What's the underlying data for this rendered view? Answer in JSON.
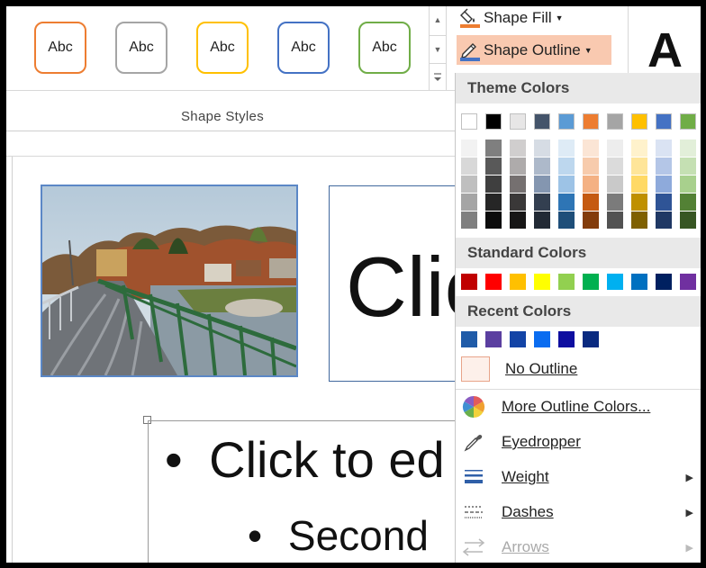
{
  "ribbon": {
    "style_buttons": [
      {
        "label": "Abc",
        "border": "#ed7d31"
      },
      {
        "label": "Abc",
        "border": "#a5a5a5"
      },
      {
        "label": "Abc",
        "border": "#ffc000"
      },
      {
        "label": "Abc",
        "border": "#4472c4"
      },
      {
        "label": "Abc",
        "border": "#70ad47"
      }
    ],
    "group_label": "Shape Styles",
    "shape_fill": "Shape Fill",
    "shape_outline": "Shape Outline",
    "wordart_glyph": "A"
  },
  "slide": {
    "title_text": "Clic",
    "bullet1": "Click to ed",
    "bullet2": "Second"
  },
  "dropdown": {
    "theme_colors_label": "Theme Colors",
    "theme_top_row": [
      "#ffffff",
      "#000000",
      "#e7e6e6",
      "#44546a",
      "#5b9bd5",
      "#ed7d31",
      "#a5a5a5",
      "#ffc000",
      "#4472c4",
      "#70ad47"
    ],
    "theme_shades": [
      [
        "#f2f2f2",
        "#7f7f7f",
        "#d0cece",
        "#d6dce4",
        "#deebf6",
        "#fbe5d5",
        "#ededed",
        "#fff2cc",
        "#dae3f3",
        "#e2efd9"
      ],
      [
        "#d8d8d8",
        "#595959",
        "#aeabab",
        "#adb9ca",
        "#bdd7ee",
        "#f7cbac",
        "#dbdbdb",
        "#fee599",
        "#b4c6e7",
        "#c5e0b3"
      ],
      [
        "#bfbfbf",
        "#3f3f3f",
        "#757070",
        "#8496b0",
        "#9dc3e6",
        "#f4b183",
        "#c9c9c9",
        "#ffd965",
        "#8eaadb",
        "#a8d08d"
      ],
      [
        "#a5a5a5",
        "#262626",
        "#3a3838",
        "#333f50",
        "#2e75b5",
        "#c55a11",
        "#7b7b7b",
        "#bf9000",
        "#2f5496",
        "#538135"
      ],
      [
        "#7f7f7f",
        "#0c0c0c",
        "#171616",
        "#222a35",
        "#1e4e79",
        "#833c0b",
        "#525252",
        "#7f6000",
        "#1f3864",
        "#375623"
      ]
    ],
    "standard_colors_label": "Standard Colors",
    "standard_colors": [
      "#c00000",
      "#ff0000",
      "#ffc000",
      "#ffff00",
      "#92d050",
      "#00b050",
      "#00b0f0",
      "#0070c0",
      "#002060",
      "#7030a0"
    ],
    "recent_colors_label": "Recent Colors",
    "recent_colors": [
      "#1f5ba8",
      "#5b3fa0",
      "#1344a6",
      "#0a6cf0",
      "#0e0ea0",
      "#0a2a80"
    ],
    "no_outline": "No Outline",
    "more_colors": "More Outline Colors...",
    "eyedropper": "Eyedropper",
    "weight": "Weight",
    "dashes": "Dashes",
    "arrows": "Arrows"
  }
}
